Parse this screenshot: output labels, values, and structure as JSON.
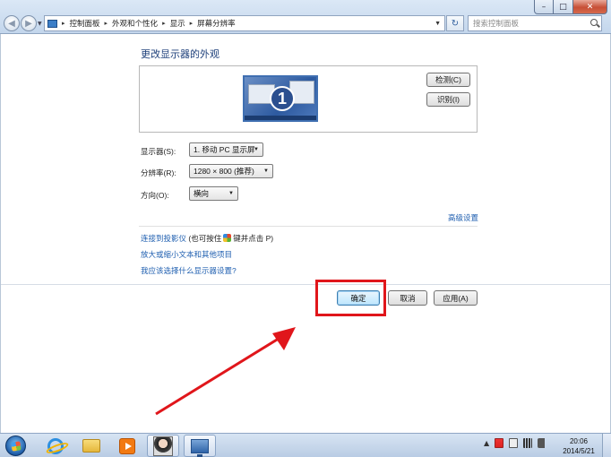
{
  "window": {
    "minimize_glyph": "–",
    "maximize_glyph": "□",
    "close_glyph": "✕"
  },
  "breadcrumb": {
    "items": [
      "控制面板",
      "外观和个性化",
      "显示",
      "屏幕分辨率"
    ],
    "separator": "▸"
  },
  "search": {
    "placeholder": "搜索控制面板"
  },
  "page": {
    "title": "更改显示器的外观"
  },
  "monitor_preview": {
    "number": "1"
  },
  "buttons": {
    "detect": "检测(C)",
    "identify": "识别(I)",
    "ok": "确定",
    "cancel": "取消",
    "apply": "应用(A)"
  },
  "fields": {
    "display": {
      "label": "显示器(S):",
      "value": "1. 移动 PC 显示屏"
    },
    "resolution": {
      "label": "分辨率(R):",
      "value": "1280 × 800 (推荐)"
    },
    "orientation": {
      "label": "方向(O):",
      "value": "横向"
    }
  },
  "links": {
    "advanced": "高级设置",
    "projector": "连接到投影仪",
    "projector_hint_before": "(也可按住",
    "projector_hint_after": "键并点击 P)",
    "text_size": "放大或缩小文本和其他项目",
    "which_settings": "我应该选择什么显示器设置?"
  },
  "annotation": {
    "highlight_color": "#e0161b",
    "arrow_color": "#e0161b"
  },
  "taskbar": {
    "apps": [
      "internet-explorer",
      "windows-explorer",
      "media-player",
      "user-photo",
      "display-settings"
    ],
    "tray_arrow": "▲",
    "time": "20:06",
    "date": "2014/5/21"
  },
  "colors": {
    "link": "#1f5fb0",
    "title": "#1d3f7a",
    "ok_button": "#bee6fd"
  }
}
